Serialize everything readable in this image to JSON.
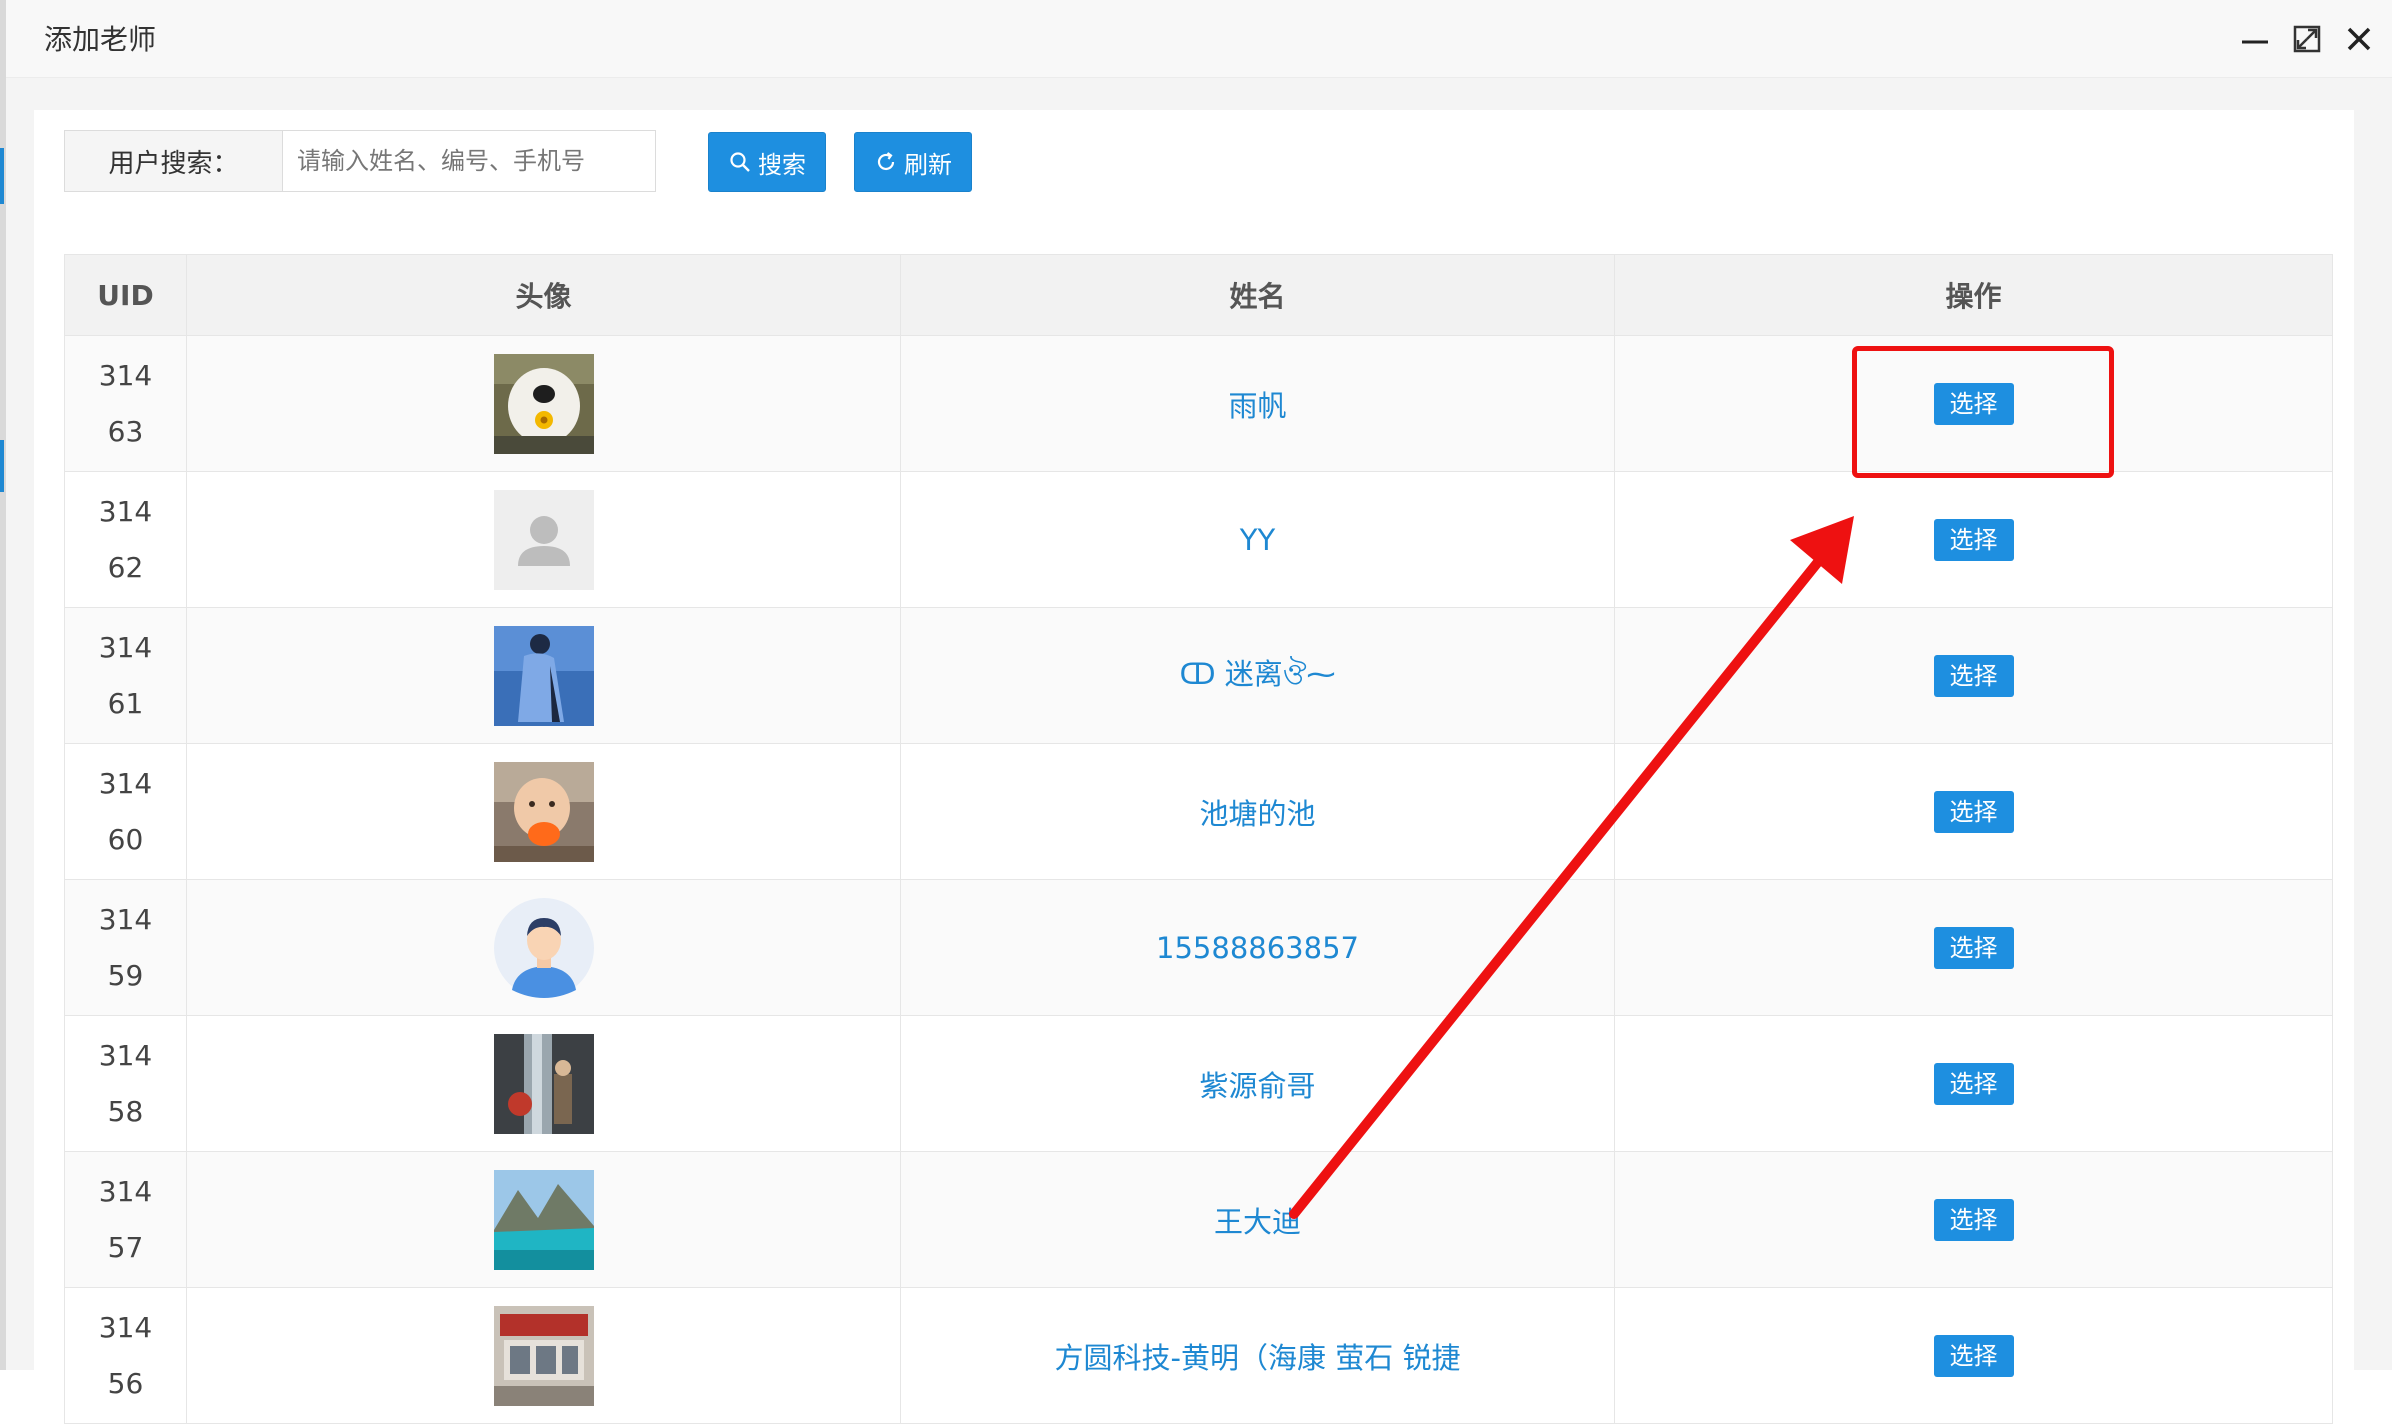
{
  "window": {
    "title": "添加老师"
  },
  "search": {
    "label": "用户搜索：",
    "placeholder": "请输入姓名、编号、手机号",
    "value": ""
  },
  "toolbar": {
    "search_label": "搜索",
    "refresh_label": "刷新"
  },
  "table": {
    "columns": [
      "UID",
      "头像",
      "姓名",
      "操作"
    ],
    "action_label": "选择",
    "rows": [
      {
        "uid_top": "314",
        "uid_bottom": "63",
        "avatar": "dog-flower-photo",
        "name": "雨帆"
      },
      {
        "uid_top": "314",
        "uid_bottom": "62",
        "avatar": "default-person-icon",
        "name": "YY"
      },
      {
        "uid_top": "314",
        "uid_bottom": "61",
        "avatar": "blue-coat-figure-photo",
        "name": "ↀ 迷离ঔ⁓"
      },
      {
        "uid_top": "314",
        "uid_bottom": "60",
        "avatar": "baby-photo",
        "name": "池塘的池"
      },
      {
        "uid_top": "314",
        "uid_bottom": "59",
        "avatar": "cartoon-man-avatar",
        "name": "15588863857"
      },
      {
        "uid_top": "314",
        "uid_bottom": "58",
        "avatar": "waterfall-people-photo",
        "name": "紫源俞哥"
      },
      {
        "uid_top": "314",
        "uid_bottom": "57",
        "avatar": "mountain-lake-photo",
        "name": "王大迪"
      },
      {
        "uid_top": "314",
        "uid_bottom": "56",
        "avatar": "storefront-photo",
        "name": "方圆科技-黄明（海康 萤石 锐捷"
      }
    ]
  },
  "colors": {
    "accent": "#1e8fe0",
    "link": "#1e88d2",
    "annotation": "#ee1111"
  }
}
